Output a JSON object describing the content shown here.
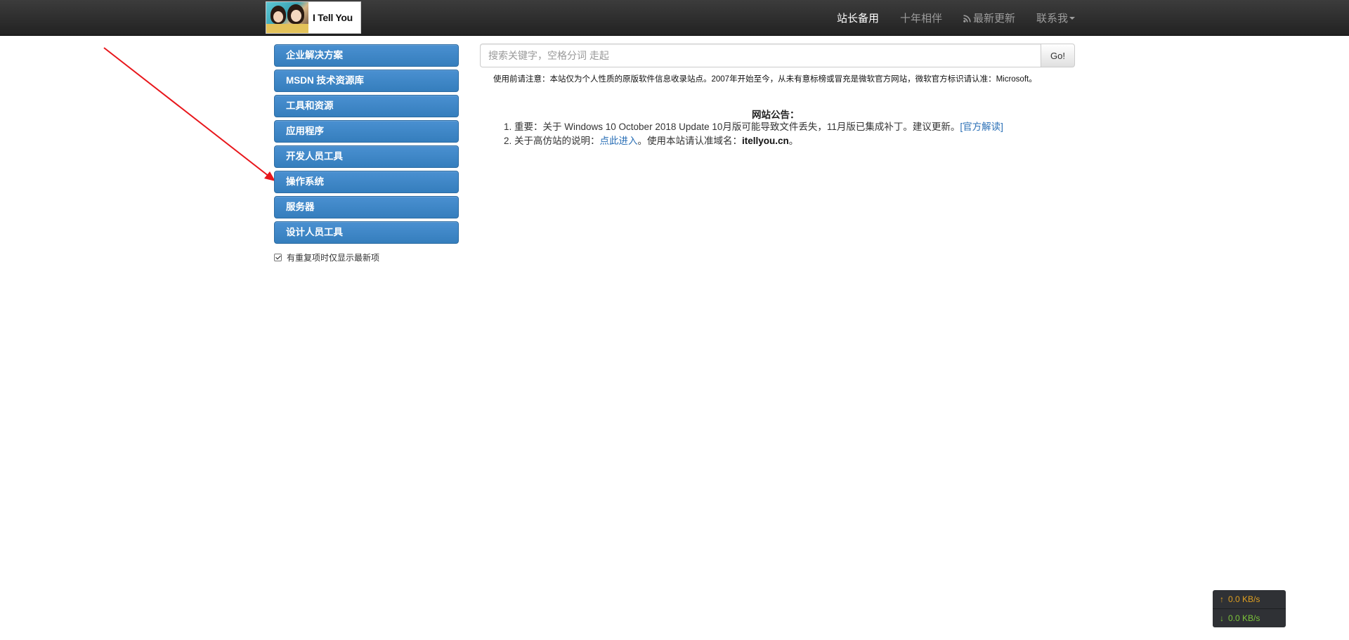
{
  "brand": {
    "text": "I Tell You"
  },
  "nav": {
    "items": [
      {
        "label": "站长备用",
        "active": true
      },
      {
        "label": "十年相伴",
        "active": false
      },
      {
        "label": "最新更新",
        "icon": "rss-icon",
        "active": false
      },
      {
        "label": "联系我",
        "dropdown": true,
        "active": false
      }
    ]
  },
  "sidebar": {
    "items": [
      {
        "label": "企业解决方案"
      },
      {
        "label": "MSDN 技术资源库"
      },
      {
        "label": "工具和资源"
      },
      {
        "label": "应用程序"
      },
      {
        "label": "开发人员工具"
      },
      {
        "label": "操作系统"
      },
      {
        "label": "服务器"
      },
      {
        "label": "设计人员工具"
      }
    ],
    "checkbox": {
      "label": "有重复项时仅显示最新项",
      "checked": true
    }
  },
  "search": {
    "placeholder": "搜索关键字，空格分词 走起",
    "value": "",
    "button_label": "Go!"
  },
  "notice": "使用前请注意：本站仅为个人性质的原版软件信息收录站点。2007年开始至今，从未有意标榜或冒充是微软官方网站，微软官方标识请认准：Microsoft。",
  "announcement": {
    "title": "网站公告：",
    "item1": {
      "text": "1. 重要：关于 Windows 10 October 2018 Update 10月版可能导致文件丢失，11月版已集成补丁。建议更新。",
      "link": "[官方解读]"
    },
    "item2": {
      "prefix": "2. 关于高仿站的说明：",
      "link": "点此进入",
      "middle": "。使用本站请认准域名：",
      "domain": "itellyou.cn",
      "suffix": "。"
    }
  },
  "speed_widget": {
    "upload": "0.0 KB/s",
    "download": "0.0 KB/s",
    "upload_color": "#e0a020",
    "download_color": "#7cc53a"
  },
  "colors": {
    "navbar": "#222222",
    "primary_button": "#428bca",
    "link": "#2a6fb6",
    "annotation_arrow": "#e8161b"
  }
}
